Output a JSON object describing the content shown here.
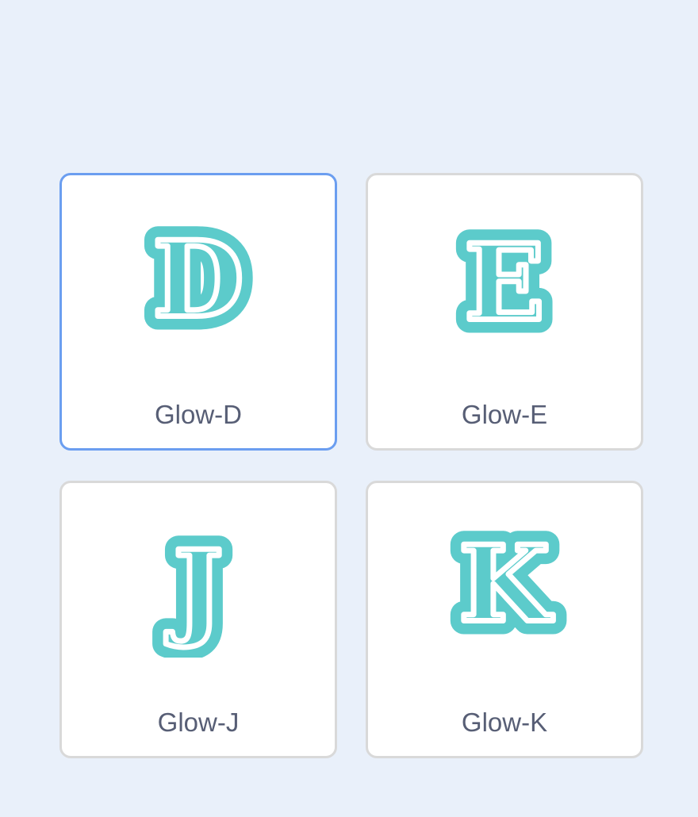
{
  "colors": {
    "page_background": "#e9f0fa",
    "tile_background": "#ffffff",
    "tile_border": "#d9d9d9",
    "selected_border": "#6b9ef0",
    "glyph_fill": "#5ccbcb",
    "glyph_stroke": "#ffffff",
    "label_text": "#575e75"
  },
  "items": [
    {
      "label": "Glow-D",
      "letter": "D",
      "selected": true
    },
    {
      "label": "Glow-E",
      "letter": "E",
      "selected": false
    },
    {
      "label": "Glow-J",
      "letter": "J",
      "selected": false
    },
    {
      "label": "Glow-K",
      "letter": "K",
      "selected": false
    }
  ]
}
